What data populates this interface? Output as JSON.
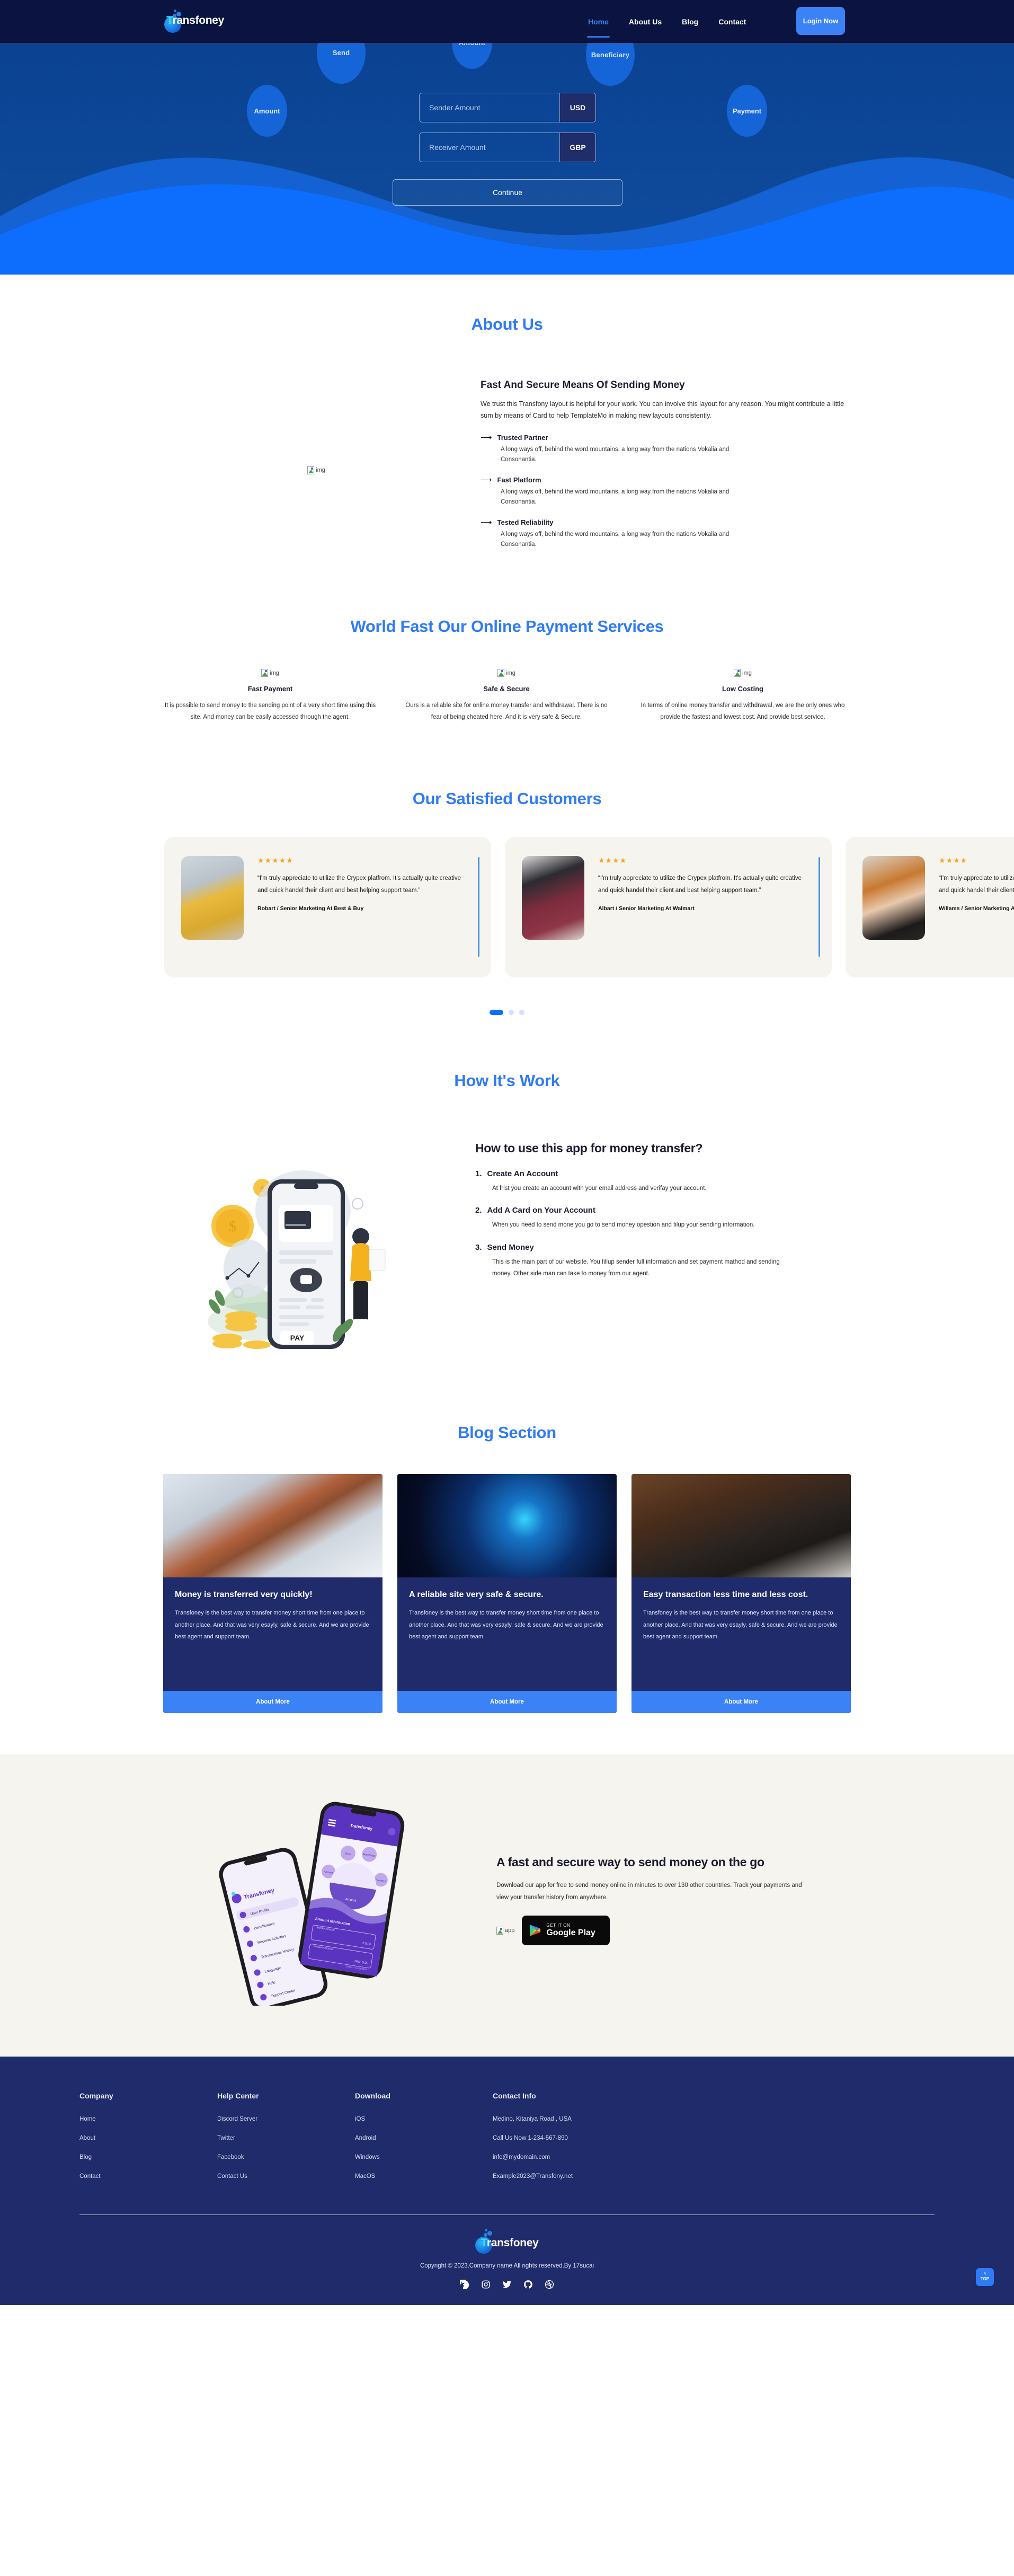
{
  "brand": {
    "name": "Transfoney",
    "name_highlight": "T",
    "name_rest": "ransfoney"
  },
  "nav": {
    "links": [
      {
        "label": "Home",
        "active": true
      },
      {
        "label": "About Us",
        "active": false
      },
      {
        "label": "Blog",
        "active": false
      },
      {
        "label": "Contact",
        "active": false
      }
    ],
    "login_label": "Login Now"
  },
  "hero": {
    "steps": [
      {
        "label": "Send"
      },
      {
        "label": "Amount"
      },
      {
        "label": "Beneficiary"
      }
    ],
    "side_left_label": "Amount",
    "side_right_label": "Payment",
    "sender_placeholder": "Sender Amount",
    "sender_value": "",
    "sender_currency": "USD",
    "receiver_placeholder": "Receiver Amount",
    "receiver_value": "",
    "receiver_currency": "GBP",
    "continue_label": "Continue"
  },
  "about": {
    "title": "About Us",
    "image_alt": "img",
    "heading": "Fast And Secure Means Of Sending Money",
    "paragraph": "We trust this Transfony layout is helpful for your work. You can involve this layout for any reason. You might contribute a little sum by means of Card to help TemplateMo in making new layouts consistently.",
    "features": [
      {
        "title": "Trusted Partner",
        "desc": "A long ways off, behind the word mountains, a long way from the nations Vokalia and Consonantia."
      },
      {
        "title": "Fast Platform",
        "desc": "A long ways off, behind the word mountains, a long way from the nations Vokalia and Consonantia."
      },
      {
        "title": "Tested Reliability",
        "desc": "A long ways off, behind the word mountains, a long way from the nations Vokalia and Consonantia."
      }
    ]
  },
  "services": {
    "title": "World Fast Our Online Payment Services",
    "items": [
      {
        "icon_alt": "img",
        "title": "Fast Payment",
        "desc": "It is possible to send money to the sending point of a very short time using this site. And money can be easily accessed through the agent."
      },
      {
        "icon_alt": "img",
        "title": "Safe & Secure",
        "desc": "Ours is a reliable site for online money transfer and withdrawal. There is no fear of being cheated here. And it is very safe & Secure."
      },
      {
        "icon_alt": "img",
        "title": "Low Costing",
        "desc": "In terms of online money transfer and withdrawal, we are the only ones who provide the fastest and lowest cost. And provide best service."
      }
    ]
  },
  "testimonials": {
    "title": "Our Satisfied Customers",
    "items": [
      {
        "stars": "★★★★★",
        "rating": 5,
        "quote": "“I'm truly appreciate to utilize the Crypex platfrom. It's actually quite creative and quick handel their client and best helping support team.”",
        "author": "Robart / Senior Marketing At Best & Buy"
      },
      {
        "stars": "★★★★",
        "rating": 4,
        "quote": "“I'm truly appreciate to utilize the Crypex platfrom. It's actually quite creative and quick handel their client and best helping support team.”",
        "author": "Albart / Senior Marketing At Walmart"
      },
      {
        "stars": "★★★★",
        "rating": 4,
        "quote": "“I'm truly appreciate to utilize the Crypex platfrom. It's actually quite creative and quick handel their client and best helping support team.”",
        "author": "Willams / Senior Marketing At Amazon"
      }
    ],
    "dots": [
      {
        "active": true
      },
      {
        "active": false
      },
      {
        "active": false
      }
    ]
  },
  "howitworks": {
    "title": "How It's Work",
    "heading": "How to use this app for money transfer?",
    "steps": [
      {
        "num": "1.",
        "title": "Create An Account",
        "desc": "At frist you create an account with your email address and verifay your account."
      },
      {
        "num": "2.",
        "title": "Add A Card on Your Account",
        "desc": "When you need to send mone you go to send money opestion and filup your sending information."
      },
      {
        "num": "3.",
        "title": "Send Money",
        "desc": "This is the main part of our website. You fillup sender full information and set payment mathod and sending money. Other side man can take to money from our agent."
      }
    ],
    "pay_label": "PAY"
  },
  "blog": {
    "title": "Blog Section",
    "cards": [
      {
        "title": "Money is transferred very quickly!",
        "desc": "Transfoney is the best way to transfer money short time from one place to another place. And that was very esayly, safe & secure. And we are provide best agent and support team.",
        "button": "About More"
      },
      {
        "title": "A reliable site very safe & secure.",
        "desc": "Transfoney is the best way to transfer money short time from one place to another place. And that was very esayly, safe & secure. And we are provide best agent and support team.",
        "button": "About More"
      },
      {
        "title": "Easy transaction less time and less cost.",
        "desc": "Transfoney is the best way to transfer money short time from one place to another place. And that was very esayly, safe & secure. And we are provide best agent and support team.",
        "button": "About More"
      }
    ]
  },
  "appsection": {
    "heading": "A fast and secure way to send money on the go",
    "paragraph": "Download our app for free to send money online in minutes to over 130 other countries. Track your payments and view your transfer history from anywhere.",
    "appstore_alt": "app",
    "googleplay_small": "GET IT ON",
    "googleplay_big": "Google Play"
  },
  "footer": {
    "columns": [
      {
        "head": "Company",
        "links": [
          "Home",
          "About",
          "Blog",
          "Contact"
        ]
      },
      {
        "head": "Help Center",
        "links": [
          "Discord Server",
          "Twitter",
          "Facebook",
          "Contact Us"
        ]
      },
      {
        "head": "Download",
        "links": [
          "iOS",
          "Android",
          "Windows",
          "MacOS"
        ]
      },
      {
        "head": "Contact Info",
        "links": [
          "Medino, Kitaniya Road , USA",
          "Call Us Now 1-234-567-890",
          "info@mydomain.com",
          "Example2023@Transfony.net"
        ]
      }
    ],
    "copyright": "Copyright © 2023.Company name All rights reserved.By 17sucai",
    "socials": [
      "facebook-icon",
      "instagram-icon",
      "twitter-icon",
      "github-icon",
      "dribbble-icon"
    ],
    "top_button": "TOP"
  },
  "colors": {
    "accent": "#2f7bf6",
    "navy": "#0b1340",
    "hero_blue": "#0b4292",
    "footer_navy": "#1f2b6b",
    "cream": "#f6f4ee",
    "star": "#f5a524"
  }
}
